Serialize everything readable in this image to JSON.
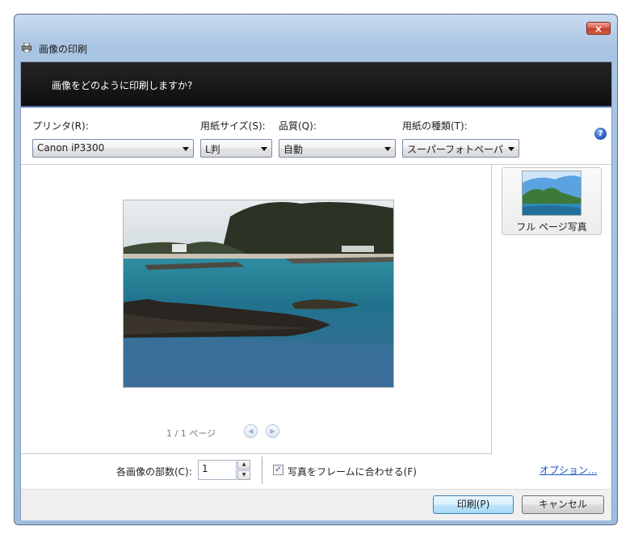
{
  "window": {
    "title": "画像の印刷",
    "close_label": "×"
  },
  "banner": {
    "text": "画像をどのように印刷しますか?"
  },
  "settings": {
    "printer": {
      "label": "プリンタ(R):",
      "value": "Canon iP3300"
    },
    "paper_size": {
      "label": "用紙サイズ(S):",
      "value": "L判"
    },
    "quality": {
      "label": "品質(Q):",
      "value": "自動"
    },
    "paper_type": {
      "label": "用紙の種類(T):",
      "value": "スーパーフォトペーパ"
    },
    "help_label": "?"
  },
  "preview": {
    "page_indicator": "1 / 1 ページ",
    "prev_label": "◀",
    "next_label": "▶"
  },
  "layouts": {
    "items": [
      {
        "label": "フル ページ写真"
      }
    ]
  },
  "bottom": {
    "copies_label": "各画像の部数(C):",
    "copies_value": "1",
    "spin_up": "▲",
    "spin_down": "▼",
    "fit_checked_glyph": "✓",
    "fit_frame_label": "写真をフレームに合わせる(F)",
    "options_link": "オプション..."
  },
  "footer": {
    "print_label": "印刷(P)",
    "cancel_label": "キャンセル"
  },
  "colors": {
    "banner_bg": "#111111",
    "accent_link": "#1a55c7",
    "close_red": "#c8402e"
  }
}
